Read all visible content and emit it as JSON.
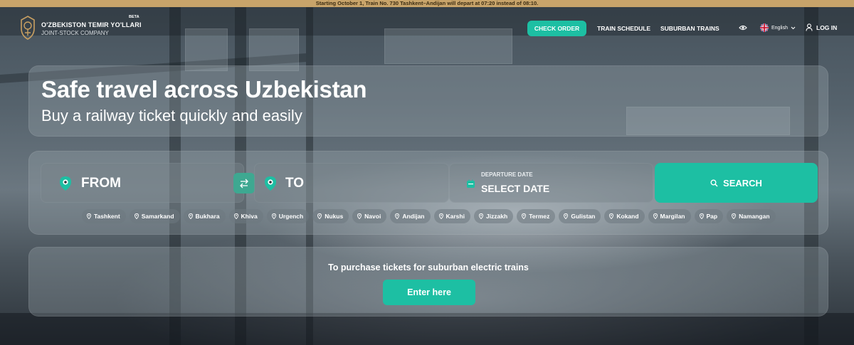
{
  "announcement": "Starting October 1, Train No. 730 Tashkent–Andijan will depart at 07:20 instead of 08:10.",
  "header": {
    "brand_name": "O'ZBEKISTON TEMIR YO'LLARI",
    "brand_sub": "JOINT-STOCK COMPANY",
    "beta": "BETA",
    "check_order": "CHECK ORDER",
    "train_schedule": "TRAIN SCHEDULE",
    "suburban_trains": "SUBURBAN TRAINS",
    "language": "English",
    "login": "LOG IN"
  },
  "hero": {
    "title": "Safe travel across Uzbekistan",
    "subtitle": "Buy a railway ticket quickly and easily"
  },
  "search": {
    "from_label": "FROM",
    "to_label": "TO",
    "date_caption": "DEPARTURE DATE",
    "date_value": "SELECT DATE",
    "search_button": "SEARCH",
    "cities": [
      "Tashkent",
      "Samarkand",
      "Bukhara",
      "Khiva",
      "Urgench",
      "Nukus",
      "Navoi",
      "Andijan",
      "Karshi",
      "Jizzakh",
      "Termez",
      "Gulistan",
      "Kokand",
      "Margilan",
      "Pap",
      "Namangan"
    ]
  },
  "suburban": {
    "text": "To purchase tickets for suburban electric trains",
    "button": "Enter here"
  },
  "colors": {
    "accent": "#1dbfa3",
    "announcement_bg": "#c8a46a"
  },
  "icons": {
    "logo": "emblem-logo",
    "eye": "eye-icon",
    "flag": "uk-flag-icon",
    "chevron": "chevron-down-icon",
    "user": "user-icon",
    "pin": "location-pin-icon",
    "swap": "swap-arrows-icon",
    "calendar": "calendar-icon",
    "search": "search-icon"
  }
}
